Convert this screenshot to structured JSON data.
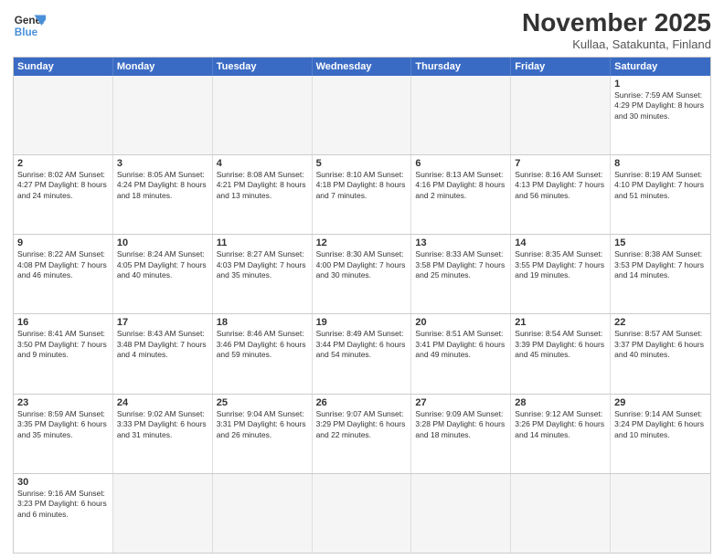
{
  "header": {
    "logo_general": "General",
    "logo_blue": "Blue",
    "month_title": "November 2025",
    "location": "Kullaa, Satakunta, Finland"
  },
  "weekdays": [
    "Sunday",
    "Monday",
    "Tuesday",
    "Wednesday",
    "Thursday",
    "Friday",
    "Saturday"
  ],
  "rows": [
    [
      {
        "day": "",
        "info": ""
      },
      {
        "day": "",
        "info": ""
      },
      {
        "day": "",
        "info": ""
      },
      {
        "day": "",
        "info": ""
      },
      {
        "day": "",
        "info": ""
      },
      {
        "day": "",
        "info": ""
      },
      {
        "day": "1",
        "info": "Sunrise: 7:59 AM\nSunset: 4:29 PM\nDaylight: 8 hours\nand 30 minutes."
      }
    ],
    [
      {
        "day": "2",
        "info": "Sunrise: 8:02 AM\nSunset: 4:27 PM\nDaylight: 8 hours\nand 24 minutes."
      },
      {
        "day": "3",
        "info": "Sunrise: 8:05 AM\nSunset: 4:24 PM\nDaylight: 8 hours\nand 18 minutes."
      },
      {
        "day": "4",
        "info": "Sunrise: 8:08 AM\nSunset: 4:21 PM\nDaylight: 8 hours\nand 13 minutes."
      },
      {
        "day": "5",
        "info": "Sunrise: 8:10 AM\nSunset: 4:18 PM\nDaylight: 8 hours\nand 7 minutes."
      },
      {
        "day": "6",
        "info": "Sunrise: 8:13 AM\nSunset: 4:16 PM\nDaylight: 8 hours\nand 2 minutes."
      },
      {
        "day": "7",
        "info": "Sunrise: 8:16 AM\nSunset: 4:13 PM\nDaylight: 7 hours\nand 56 minutes."
      },
      {
        "day": "8",
        "info": "Sunrise: 8:19 AM\nSunset: 4:10 PM\nDaylight: 7 hours\nand 51 minutes."
      }
    ],
    [
      {
        "day": "9",
        "info": "Sunrise: 8:22 AM\nSunset: 4:08 PM\nDaylight: 7 hours\nand 46 minutes."
      },
      {
        "day": "10",
        "info": "Sunrise: 8:24 AM\nSunset: 4:05 PM\nDaylight: 7 hours\nand 40 minutes."
      },
      {
        "day": "11",
        "info": "Sunrise: 8:27 AM\nSunset: 4:03 PM\nDaylight: 7 hours\nand 35 minutes."
      },
      {
        "day": "12",
        "info": "Sunrise: 8:30 AM\nSunset: 4:00 PM\nDaylight: 7 hours\nand 30 minutes."
      },
      {
        "day": "13",
        "info": "Sunrise: 8:33 AM\nSunset: 3:58 PM\nDaylight: 7 hours\nand 25 minutes."
      },
      {
        "day": "14",
        "info": "Sunrise: 8:35 AM\nSunset: 3:55 PM\nDaylight: 7 hours\nand 19 minutes."
      },
      {
        "day": "15",
        "info": "Sunrise: 8:38 AM\nSunset: 3:53 PM\nDaylight: 7 hours\nand 14 minutes."
      }
    ],
    [
      {
        "day": "16",
        "info": "Sunrise: 8:41 AM\nSunset: 3:50 PM\nDaylight: 7 hours\nand 9 minutes."
      },
      {
        "day": "17",
        "info": "Sunrise: 8:43 AM\nSunset: 3:48 PM\nDaylight: 7 hours\nand 4 minutes."
      },
      {
        "day": "18",
        "info": "Sunrise: 8:46 AM\nSunset: 3:46 PM\nDaylight: 6 hours\nand 59 minutes."
      },
      {
        "day": "19",
        "info": "Sunrise: 8:49 AM\nSunset: 3:44 PM\nDaylight: 6 hours\nand 54 minutes."
      },
      {
        "day": "20",
        "info": "Sunrise: 8:51 AM\nSunset: 3:41 PM\nDaylight: 6 hours\nand 49 minutes."
      },
      {
        "day": "21",
        "info": "Sunrise: 8:54 AM\nSunset: 3:39 PM\nDaylight: 6 hours\nand 45 minutes."
      },
      {
        "day": "22",
        "info": "Sunrise: 8:57 AM\nSunset: 3:37 PM\nDaylight: 6 hours\nand 40 minutes."
      }
    ],
    [
      {
        "day": "23",
        "info": "Sunrise: 8:59 AM\nSunset: 3:35 PM\nDaylight: 6 hours\nand 35 minutes."
      },
      {
        "day": "24",
        "info": "Sunrise: 9:02 AM\nSunset: 3:33 PM\nDaylight: 6 hours\nand 31 minutes."
      },
      {
        "day": "25",
        "info": "Sunrise: 9:04 AM\nSunset: 3:31 PM\nDaylight: 6 hours\nand 26 minutes."
      },
      {
        "day": "26",
        "info": "Sunrise: 9:07 AM\nSunset: 3:29 PM\nDaylight: 6 hours\nand 22 minutes."
      },
      {
        "day": "27",
        "info": "Sunrise: 9:09 AM\nSunset: 3:28 PM\nDaylight: 6 hours\nand 18 minutes."
      },
      {
        "day": "28",
        "info": "Sunrise: 9:12 AM\nSunset: 3:26 PM\nDaylight: 6 hours\nand 14 minutes."
      },
      {
        "day": "29",
        "info": "Sunrise: 9:14 AM\nSunset: 3:24 PM\nDaylight: 6 hours\nand 10 minutes."
      }
    ],
    [
      {
        "day": "30",
        "info": "Sunrise: 9:16 AM\nSunset: 3:23 PM\nDaylight: 6 hours\nand 6 minutes."
      },
      {
        "day": "",
        "info": ""
      },
      {
        "day": "",
        "info": ""
      },
      {
        "day": "",
        "info": ""
      },
      {
        "day": "",
        "info": ""
      },
      {
        "day": "",
        "info": ""
      },
      {
        "day": "",
        "info": ""
      }
    ]
  ]
}
